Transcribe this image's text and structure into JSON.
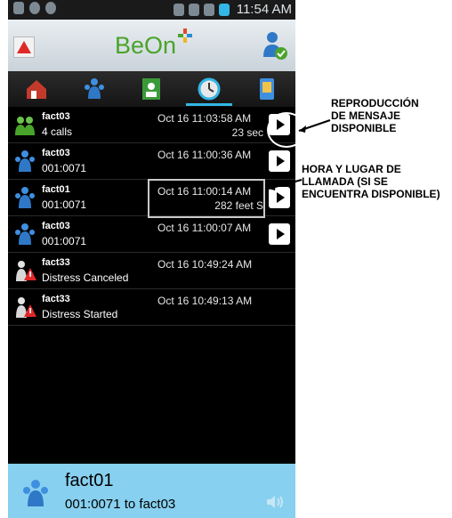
{
  "status_bar": {
    "time": "11:54 AM"
  },
  "app_bar": {
    "logo_text": "BeOn"
  },
  "tabs": [
    {
      "icon": "home-icon"
    },
    {
      "icon": "contacts-icon"
    },
    {
      "icon": "contact-card-icon"
    },
    {
      "icon": "history-clock-icon",
      "active": true
    },
    {
      "icon": "settings-device-icon"
    }
  ],
  "rows": [
    {
      "avatar": "group-green-icon",
      "name": "fact03",
      "sub": "4 calls",
      "time": "Oct 16 11:03:58 AM",
      "extra": "23 sec",
      "play": true
    },
    {
      "avatar": "group-blue-icon",
      "name": "fact03",
      "sub": "001:0071",
      "time": "Oct 16 11:00:36 AM",
      "extra": "",
      "play": true
    },
    {
      "avatar": "group-blue-icon",
      "name": "fact01",
      "sub": "001:0071",
      "time": "Oct 16 11:00:14 AM",
      "extra": "282 feet S",
      "play": true
    },
    {
      "avatar": "group-blue-icon",
      "name": "fact03",
      "sub": "001:0071",
      "time": "Oct 16 11:00:07 AM",
      "extra": "",
      "play": true
    },
    {
      "avatar": "distress-icon",
      "name": "fact33",
      "sub": "Distress Canceled",
      "time": "Oct 16 10:49:24 AM",
      "extra": "",
      "play": false
    },
    {
      "avatar": "distress-icon",
      "name": "fact33",
      "sub": "Distress Started",
      "time": "Oct 16 10:49:13 AM",
      "extra": "",
      "play": false
    }
  ],
  "bottom_bar": {
    "name": "fact01",
    "sub": "001:0071 to fact03"
  },
  "annotations": {
    "playback": "REPRODUCCIÓN\nDE MENSAJE\nDISPONIBLE",
    "time_place": "HORA Y LUGAR DE\nLLAMADA (SI SE\nENCUENTRA DISPONIBLE)"
  },
  "colors": {
    "accent": "#33b5e5",
    "bottom_bar": "#87d0ef",
    "logo": "#4aa32a"
  }
}
